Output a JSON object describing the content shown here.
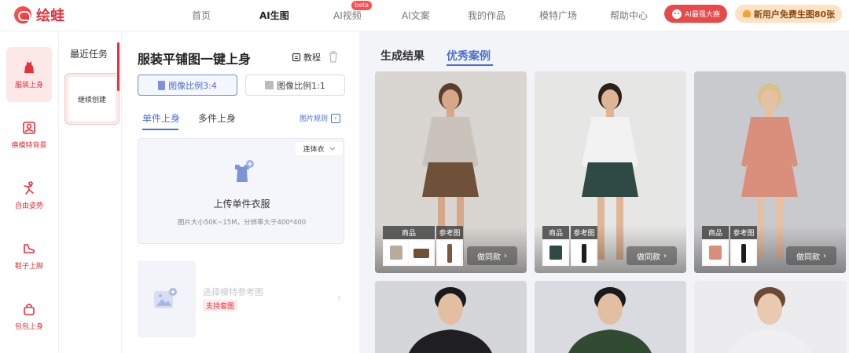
{
  "brand": {
    "name": "绘蛙"
  },
  "nav": {
    "items": [
      {
        "label": "首页",
        "active": false
      },
      {
        "label": "AI生图",
        "active": true
      },
      {
        "label": "AI视频",
        "active": false
      },
      {
        "label": "AI文案",
        "active": false
      },
      {
        "label": "我的作品",
        "active": false
      },
      {
        "label": "模特广场",
        "active": false
      },
      {
        "label": "帮助中心",
        "active": false
      }
    ],
    "beta_badge": "beta",
    "contest_label": "AI最强大赛",
    "free_label": "新用户免费生图80张"
  },
  "sidebar": {
    "items": [
      {
        "label": "服装上身",
        "icon": "dress-icon",
        "active": true
      },
      {
        "label": "换模特背景",
        "icon": "portrait-icon",
        "active": false
      },
      {
        "label": "自由姿势",
        "icon": "pose-icon",
        "active": false
      },
      {
        "label": "鞋子上脚",
        "icon": "shoe-icon",
        "active": false
      },
      {
        "label": "包包上身",
        "icon": "bag-icon",
        "active": false
      }
    ]
  },
  "recent": {
    "title": "最近任务",
    "new_task_label": "继续创建"
  },
  "panel": {
    "title": "服装平铺图一键上身",
    "tutorial_label": "教程",
    "ratio_options": [
      {
        "label": "图像比例3:4",
        "selected": true
      },
      {
        "label": "图像比例1:1",
        "selected": false
      }
    ],
    "tabs": [
      {
        "label": "单件上身",
        "active": true
      },
      {
        "label": "多件上身",
        "active": false
      }
    ],
    "rules_link": "图片规则",
    "upload": {
      "category": "连体衣",
      "title": "上传单件衣服",
      "hint": "图片大小50K~15M，分辨率大于400*400"
    },
    "model_ref": {
      "label": "选择模特参考图",
      "badge": "支持套图"
    }
  },
  "gallery": {
    "tabs": [
      {
        "label": "生成结果",
        "active": false
      },
      {
        "label": "优秀案例",
        "active": true
      }
    ],
    "card_labels": {
      "product": "商品",
      "reference": "参考图",
      "same_style": "做同款"
    },
    "cards": [
      {
        "bg": "#d9d6d2",
        "top": "#c9c3bb",
        "bottom": "#6f5038",
        "skin": "#d7a78a",
        "hair": "#5a3f2e",
        "products": [
          "#b8ad9c",
          "#7a5a3e"
        ]
      },
      {
        "bg": "#e6e6e4",
        "top": "#f2f2f2",
        "bottom": "#2f4a44",
        "skin": "#e0b596",
        "hair": "#2a211b",
        "products": [
          "#2f4a44",
          "#1c1c22"
        ]
      },
      {
        "bg": "#c9cacd",
        "top": "#d98f7c",
        "bottom": "#d98f7c",
        "skin": "#e5c0a5",
        "hair": "#d9c18b",
        "products": [
          "#d98f7c",
          "#1c1c22"
        ]
      },
      {
        "bg": "#d5d6d9",
        "top": "#1f1f22",
        "bottom": "#1f1f22",
        "skin": "#e2bfa3",
        "hair": "#1a1a1a"
      },
      {
        "bg": "#dadbe0",
        "top": "#314a32",
        "bottom": "#314a32",
        "skin": "#e2bfa3",
        "hair": "#1a1a1a"
      },
      {
        "bg": "#ececee",
        "top": "#f0f0f2",
        "bottom": "#f0f0f2",
        "skin": "#e9c9b0",
        "hair": "#6b4a35"
      }
    ]
  },
  "colors": {
    "brand_red": "#e8303a",
    "accent_blue": "#4c6fd0"
  }
}
